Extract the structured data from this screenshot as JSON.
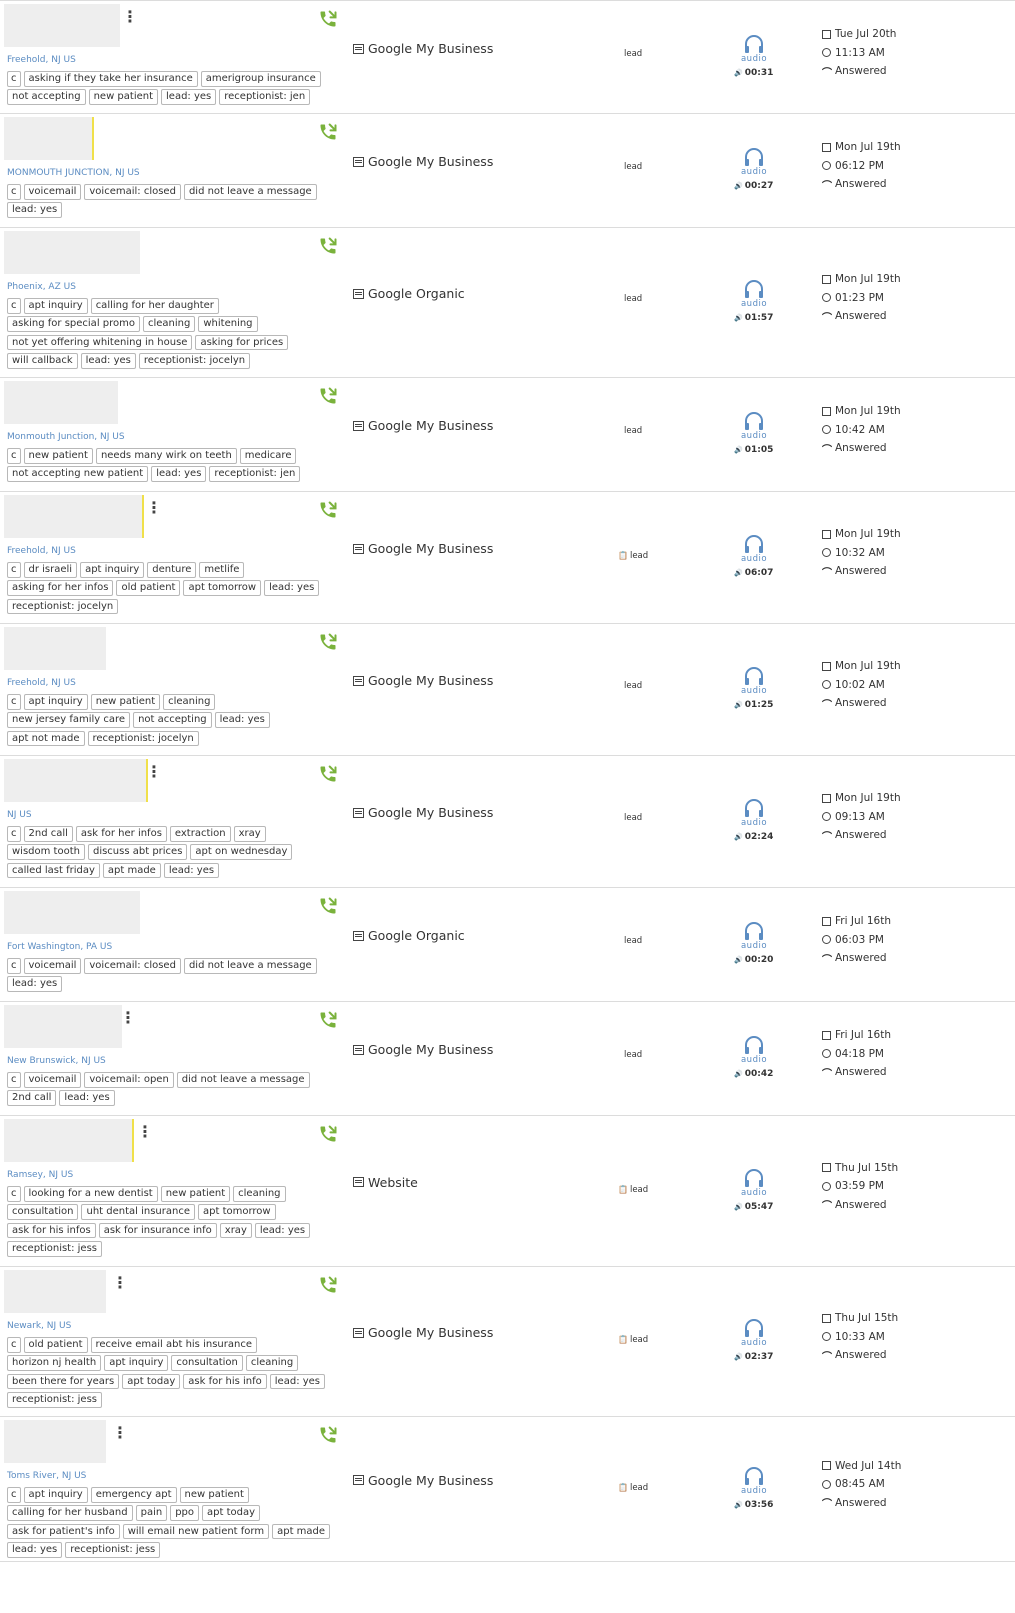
{
  "calls": [
    {
      "location": "Freehold, NJ US",
      "tag_lines": [
        [
          "c",
          "asking if they take her insurance",
          "amerigroup insurance"
        ],
        [
          "not accepting",
          "new patient",
          "lead: yes",
          "receptionist: jen"
        ]
      ],
      "source": "Google My Business",
      "lead_label": "lead",
      "audio_label": "audio",
      "duration": "00:31",
      "date": "Tue Jul 20th",
      "time": "11:13 AM",
      "status": "Answered"
    },
    {
      "location": "MONMOUTH JUNCTION, NJ US",
      "tag_lines": [
        [
          "c",
          "voicemail",
          "voicemail: closed",
          "did not leave a message"
        ],
        [
          "lead: yes"
        ]
      ],
      "source": "Google My Business",
      "lead_label": "lead",
      "audio_label": "audio",
      "duration": "00:27",
      "date": "Mon Jul 19th",
      "time": "06:12 PM",
      "status": "Answered"
    },
    {
      "location": "Phoenix, AZ US",
      "tag_lines": [
        [
          "c",
          "apt inquiry",
          "calling for her daughter"
        ],
        [
          "asking for special promo",
          "cleaning",
          "whitening"
        ],
        [
          "not yet offering whitening in house",
          "asking for prices"
        ],
        [
          "will callback",
          "lead: yes",
          "receptionist: jocelyn"
        ]
      ],
      "source": "Google Organic",
      "lead_label": "lead",
      "audio_label": "audio",
      "duration": "01:57",
      "date": "Mon Jul 19th",
      "time": "01:23 PM",
      "status": "Answered"
    },
    {
      "location": "Monmouth Junction, NJ US",
      "tag_lines": [
        [
          "c",
          "new patient",
          "needs many wirk on teeth",
          "medicare"
        ],
        [
          "not accepting new patient",
          "lead: yes",
          "receptionist: jen"
        ]
      ],
      "source": "Google My Business",
      "lead_label": "lead",
      "audio_label": "audio",
      "duration": "01:05",
      "date": "Mon Jul 19th",
      "time": "10:42 AM",
      "status": "Answered"
    },
    {
      "location": "Freehold, NJ US",
      "tag_lines": [
        [
          "c",
          "dr israeli",
          "apt inquiry",
          "denture",
          "metlife"
        ],
        [
          "asking for her infos",
          "old patient",
          "apt tomorrow",
          "lead: yes"
        ],
        [
          "receptionist: jocelyn"
        ]
      ],
      "source": "Google My Business",
      "lead_label": "lead",
      "audio_label": "audio",
      "duration": "06:07",
      "date": "Mon Jul 19th",
      "time": "10:32 AM",
      "status": "Answered"
    },
    {
      "location": "Freehold, NJ US",
      "tag_lines": [
        [
          "c",
          "apt inquiry",
          "new patient",
          "cleaning"
        ],
        [
          "new jersey family care",
          "not accepting",
          "lead: yes"
        ],
        [
          "apt not made",
          "receptionist: jocelyn"
        ]
      ],
      "source": "Google My Business",
      "lead_label": "lead",
      "audio_label": "audio",
      "duration": "01:25",
      "date": "Mon Jul 19th",
      "time": "10:02 AM",
      "status": "Answered"
    },
    {
      "location": "NJ US",
      "tag_lines": [
        [
          "c",
          "2nd call",
          "ask for her infos",
          "extraction",
          "xray"
        ],
        [
          "wisdom tooth",
          "discuss abt prices",
          "apt on wednesday"
        ],
        [
          "called last friday",
          "apt made",
          "lead: yes"
        ]
      ],
      "source": "Google My Business",
      "lead_label": "lead",
      "audio_label": "audio",
      "duration": "02:24",
      "date": "Mon Jul 19th",
      "time": "09:13 AM",
      "status": "Answered"
    },
    {
      "location": "Fort Washington, PA US",
      "tag_lines": [
        [
          "c",
          "voicemail",
          "voicemail: closed",
          "did not leave a message"
        ],
        [
          "lead: yes"
        ]
      ],
      "source": "Google Organic",
      "lead_label": "lead",
      "audio_label": "audio",
      "duration": "00:20",
      "date": "Fri Jul 16th",
      "time": "06:03 PM",
      "status": "Answered"
    },
    {
      "location": "New Brunswick, NJ US",
      "tag_lines": [
        [
          "c",
          "voicemail",
          "voicemail: open",
          "did not leave a message"
        ],
        [
          "2nd call",
          "lead: yes"
        ]
      ],
      "source": "Google My Business",
      "lead_label": "lead",
      "audio_label": "audio",
      "duration": "00:42",
      "date": "Fri Jul 16th",
      "time": "04:18 PM",
      "status": "Answered"
    },
    {
      "location": "Ramsey, NJ US",
      "tag_lines": [
        [
          "c",
          "looking for a new dentist",
          "new patient",
          "cleaning"
        ],
        [
          "consultation",
          "uht dental insurance",
          "apt tomorrow"
        ],
        [
          "ask for his infos",
          "ask for insurance info",
          "xray",
          "lead: yes"
        ],
        [
          "receptionist: jess"
        ]
      ],
      "source": "Website",
      "lead_label": "lead",
      "audio_label": "audio",
      "duration": "05:47",
      "date": "Thu Jul 15th",
      "time": "03:59 PM",
      "status": "Answered"
    },
    {
      "location": "Newark, NJ US",
      "tag_lines": [
        [
          "c",
          "old patient",
          "receive email abt his insurance"
        ],
        [
          "horizon nj health",
          "apt inquiry",
          "consultation",
          "cleaning"
        ],
        [
          "been there for years",
          "apt today",
          "ask for his info",
          "lead: yes"
        ],
        [
          "receptionist: jess"
        ]
      ],
      "source": "Google My Business",
      "lead_label": "lead",
      "audio_label": "audio",
      "duration": "02:37",
      "date": "Thu Jul 15th",
      "time": "10:33 AM",
      "status": "Answered"
    },
    {
      "location": "Toms River, NJ US",
      "tag_lines": [
        [
          "c",
          "apt inquiry",
          "emergency apt",
          "new patient"
        ],
        [
          "calling for her husband",
          "pain",
          "ppo",
          "apt today"
        ],
        [
          "ask for patient's info",
          "will email new patient form",
          "apt made"
        ],
        [
          "lead: yes",
          "receptionist: jess"
        ]
      ],
      "source": "Google My Business",
      "lead_label": "lead",
      "audio_label": "audio",
      "duration": "03:56",
      "date": "Wed Jul 14th",
      "time": "08:45 AM",
      "status": "Answered"
    }
  ],
  "colors": {
    "phone_icon": "#7ab23c",
    "audio_icon": "#5b8cc2",
    "location_text": "#5b8cc2",
    "avatar_bar": "#f0e04a"
  },
  "icons": {
    "phone": "phone-incoming-icon",
    "source": "newspaper-icon",
    "audio": "headphones-icon",
    "duration": "speaker-icon",
    "date": "calendar-icon",
    "time": "clock-icon",
    "status": "answered-call-icon",
    "lead": "clipboard-icon"
  }
}
